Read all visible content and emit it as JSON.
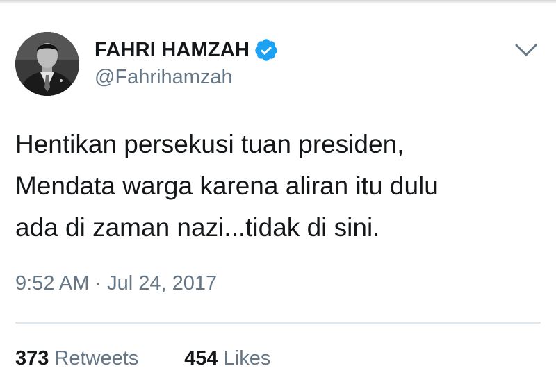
{
  "tweet": {
    "author": {
      "display_name": "FAHRI HAMZAH",
      "handle": "@Fahrihamzah",
      "verified": true,
      "avatar_icon": "profile-photo",
      "verified_icon": "verified-badge-icon"
    },
    "text": "Hentikan persekusi tuan presiden,\nMendata warga karena aliran itu dulu\nada di zaman nazi...tidak di sini.",
    "timestamp": "9:52 AM · Jul 24, 2017",
    "stats": {
      "retweets_count": "373",
      "retweets_label": "Retweets",
      "likes_count": "454",
      "likes_label": "Likes"
    },
    "menu_icon": "chevron-down-icon"
  },
  "colors": {
    "text_primary": "#14171a",
    "text_secondary": "#657786",
    "verified": "#1da1f2",
    "divider": "#e1e8ed"
  }
}
